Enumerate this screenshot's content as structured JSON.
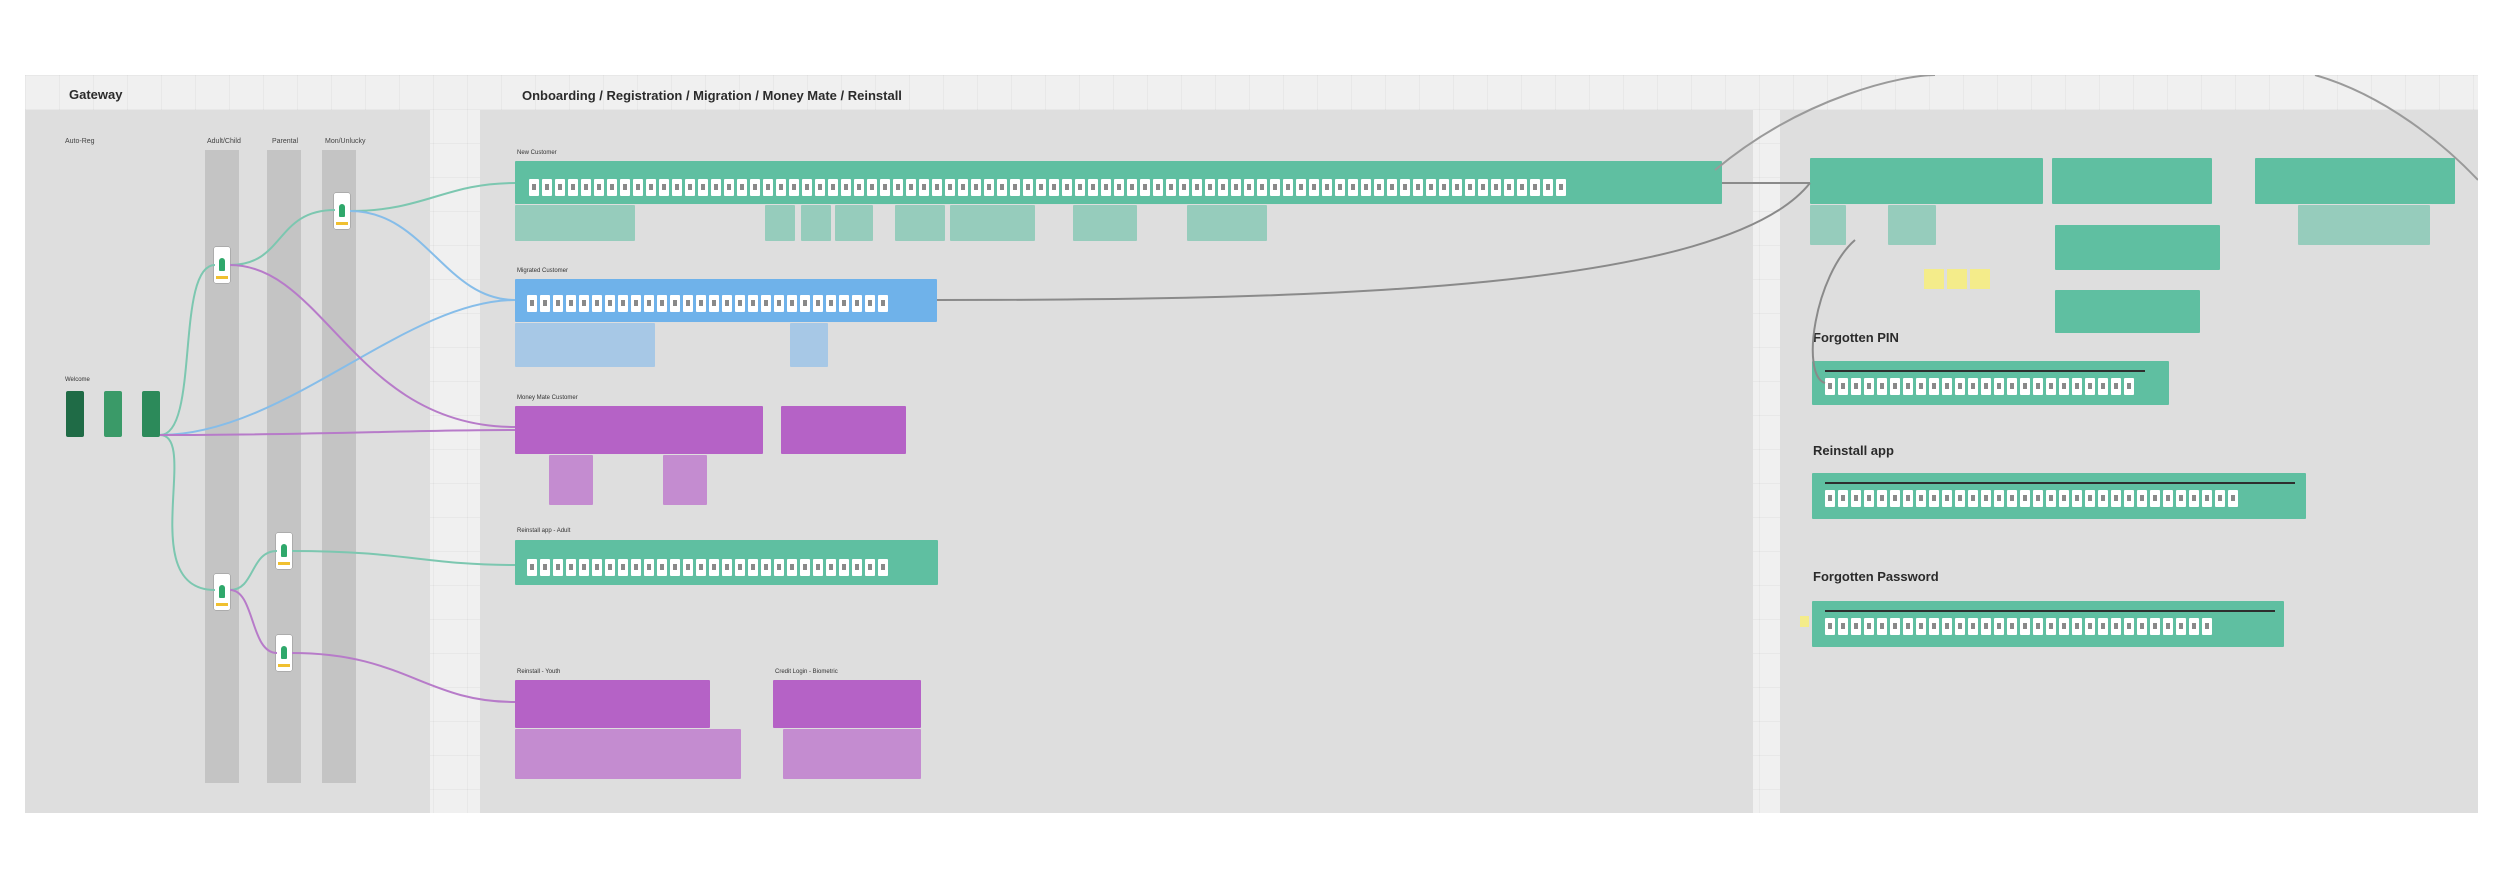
{
  "sections": {
    "gateway": {
      "title": "Gateway"
    },
    "onboarding": {
      "title": "Onboarding / Registration / Migration / Money Mate / Reinstall"
    }
  },
  "gateway": {
    "lanes": [
      "Auto-Reg",
      "Adult/Child",
      "Parental",
      "Mon/Unlucky"
    ],
    "entry_label": "Welcome"
  },
  "flows": {
    "new_customer": "New Customer",
    "migrated_customer": "Migrated Customer",
    "money_mate_customer": "Money Mate Customer",
    "reinstall_adult": "Reinstall app - Adult",
    "reinstall_youth": "Reinstall - Youth",
    "credit_login": "Credit Login - Biometric"
  },
  "right_groups": {
    "forgotten_pin": "Forgotten PIN",
    "reinstall_app": "Reinstall app",
    "forgotten_password": "Forgotten Password"
  },
  "colors": {
    "green": "#5fbfa1",
    "blue": "#6fb2ea",
    "purple": "#b562c6",
    "sticky": "#f4ec8a",
    "connector_green": "#7cc7b0",
    "connector_blue": "#86bde9",
    "connector_purple": "#b77bc9",
    "connector_gray": "#8a8a8a"
  },
  "icons": [
    "person-icon",
    "phone-screen"
  ]
}
